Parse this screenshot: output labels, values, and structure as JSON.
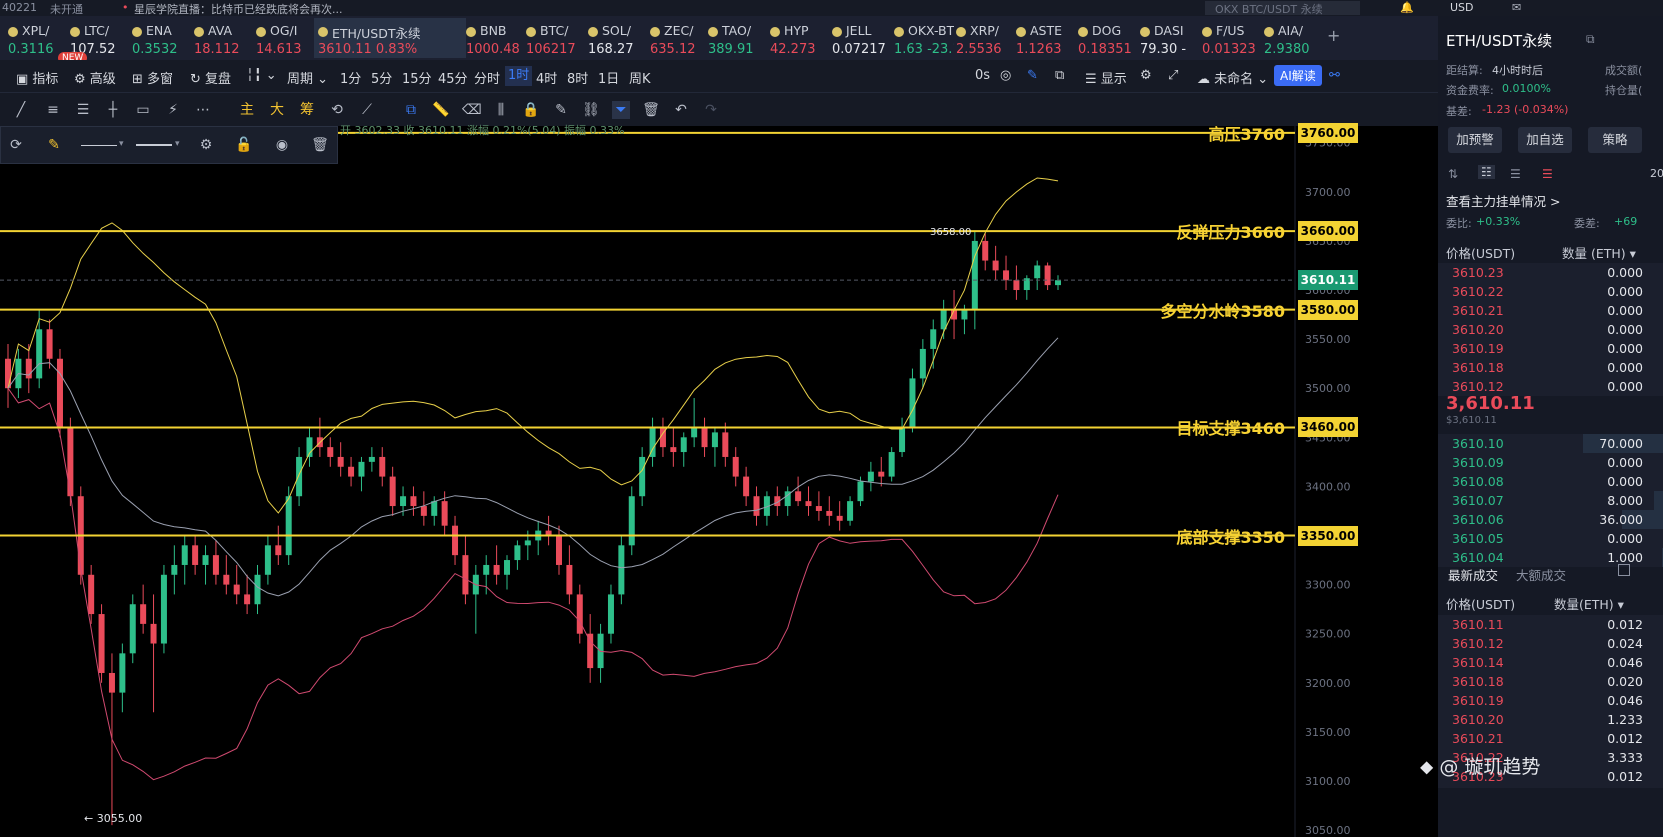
{
  "topbar": {
    "left_code": "40221",
    "badge": "未开通",
    "news": "星辰学院直播：比特币已经跌底将会再次...",
    "search_placeholder": "OKX BTC/USDT 永续",
    "currency": "USD"
  },
  "tickers": [
    {
      "name": "XPL/",
      "price": "0.3116",
      "dir": "up"
    },
    {
      "name": "LTC/",
      "price": "107.52",
      "dir": "wh"
    },
    {
      "name": "ENA",
      "price": "0.3532",
      "dir": "up"
    },
    {
      "name": "AVA",
      "price": "18.112",
      "dir": "dn"
    },
    {
      "name": "OG/I",
      "price": "14.613",
      "dir": "dn"
    },
    {
      "name": "ETH/USDT永续",
      "price": "3610.11  0.83%",
      "dir": "dn",
      "active": true
    },
    {
      "name": "BNB",
      "price": "1000.48",
      "dir": "dn"
    },
    {
      "name": "BTC/",
      "price": "106217",
      "dir": "dn"
    },
    {
      "name": "SOL/",
      "price": "168.27",
      "dir": "wh"
    },
    {
      "name": "ZEC/",
      "price": "635.12",
      "dir": "dn"
    },
    {
      "name": "TAO/",
      "price": "389.91",
      "dir": "up"
    },
    {
      "name": "HYP",
      "price": "42.273",
      "dir": "dn"
    },
    {
      "name": "JELL",
      "price": "0.07217",
      "dir": "wh"
    },
    {
      "name": "OKX-BTC",
      "price": "1.63  -23.1",
      "dir": "up"
    },
    {
      "name": "XRP/",
      "price": "2.5536",
      "dir": "dn"
    },
    {
      "name": "ASTE",
      "price": "1.1263",
      "dir": "dn"
    },
    {
      "name": "DOG",
      "price": "0.18351",
      "dir": "dn"
    },
    {
      "name": "DASI",
      "price": "79.30  -",
      "dir": "wh"
    },
    {
      "name": "F/US",
      "price": "0.01323",
      "dir": "dn"
    },
    {
      "name": "AIA/",
      "price": "2.9380",
      "dir": "up"
    }
  ],
  "new_badge": "NEW",
  "toolbar": {
    "indicators": "指标",
    "advanced": "高级",
    "multi": "多窗",
    "replay": "复盘",
    "period": "周期",
    "periods": [
      "1分",
      "5分",
      "15分",
      "45分",
      "分时",
      "1时",
      "4时",
      "8时",
      "1日",
      "周K"
    ],
    "active_period": "1时",
    "countdown": "0s",
    "display": "显示",
    "unnamed": "未命名",
    "ai": "AI解读"
  },
  "tools2": {
    "main": "主",
    "big": "大",
    "chips": "筹"
  },
  "ohlc_line": "开 3602.33  收 3610.11  涨幅 0.21%(5.04)  振幅 0.33%",
  "levels": [
    {
      "label": "高压3760",
      "tag": "3760.00",
      "price": 3760
    },
    {
      "label": "反弹压力3660",
      "tag": "3660.00",
      "price": 3660
    },
    {
      "label": "多空分水岭3580",
      "tag": "3580.00",
      "price": 3580
    },
    {
      "label": "目标支撑3460",
      "tag": "3460.00",
      "price": 3460
    },
    {
      "label": "底部支撑3350",
      "tag": "3350.00",
      "price": 3350
    }
  ],
  "current_price_tag": "3610.11",
  "high_marker": "3658.00",
  "low_marker": "← 3055.00",
  "y_ticks": [
    "3750.00",
    "3700.00",
    "3650.00",
    "3600.00",
    "3550.00",
    "3500.00",
    "3450.00",
    "3400.00",
    "3350.00",
    "3300.00",
    "3250.00",
    "3200.00",
    "3150.00",
    "3100.00",
    "3050.00"
  ],
  "chart_data": {
    "type": "candlestick",
    "title": "ETH/USDT永续 1时",
    "ylim": [
      3045,
      3765
    ],
    "candles": [
      [
        3530,
        3545,
        3480,
        3500
      ],
      [
        3500,
        3540,
        3490,
        3530
      ],
      [
        3530,
        3545,
        3495,
        3510
      ],
      [
        3510,
        3580,
        3500,
        3560
      ],
      [
        3560,
        3570,
        3520,
        3530
      ],
      [
        3530,
        3540,
        3450,
        3460
      ],
      [
        3460,
        3470,
        3380,
        3390
      ],
      [
        3390,
        3400,
        3300,
        3310
      ],
      [
        3310,
        3320,
        3260,
        3270
      ],
      [
        3270,
        3280,
        3200,
        3210
      ],
      [
        3210,
        3230,
        3055,
        3190
      ],
      [
        3190,
        3240,
        3170,
        3230
      ],
      [
        3230,
        3290,
        3220,
        3280
      ],
      [
        3280,
        3300,
        3250,
        3260
      ],
      [
        3260,
        3290,
        3170,
        3240
      ],
      [
        3240,
        3320,
        3230,
        3310
      ],
      [
        3310,
        3340,
        3290,
        3320
      ],
      [
        3320,
        3350,
        3300,
        3340
      ],
      [
        3340,
        3350,
        3310,
        3320
      ],
      [
        3320,
        3340,
        3300,
        3330
      ],
      [
        3330,
        3345,
        3300,
        3310
      ],
      [
        3310,
        3330,
        3290,
        3300
      ],
      [
        3300,
        3320,
        3280,
        3290
      ],
      [
        3290,
        3310,
        3270,
        3280
      ],
      [
        3280,
        3320,
        3270,
        3310
      ],
      [
        3310,
        3350,
        3300,
        3340
      ],
      [
        3340,
        3360,
        3320,
        3330
      ],
      [
        3330,
        3400,
        3320,
        3390
      ],
      [
        3390,
        3440,
        3380,
        3430
      ],
      [
        3430,
        3460,
        3420,
        3450
      ],
      [
        3450,
        3470,
        3430,
        3440
      ],
      [
        3440,
        3450,
        3420,
        3430
      ],
      [
        3430,
        3445,
        3410,
        3420
      ],
      [
        3420,
        3430,
        3400,
        3410
      ],
      [
        3410,
        3430,
        3395,
        3425
      ],
      [
        3425,
        3440,
        3415,
        3430
      ],
      [
        3430,
        3440,
        3400,
        3410
      ],
      [
        3410,
        3420,
        3370,
        3380
      ],
      [
        3380,
        3400,
        3370,
        3390
      ],
      [
        3390,
        3400,
        3370,
        3380
      ],
      [
        3380,
        3395,
        3360,
        3370
      ],
      [
        3370,
        3390,
        3360,
        3385
      ],
      [
        3385,
        3395,
        3350,
        3360
      ],
      [
        3360,
        3370,
        3320,
        3330
      ],
      [
        3330,
        3350,
        3280,
        3290
      ],
      [
        3290,
        3320,
        3250,
        3310
      ],
      [
        3310,
        3330,
        3290,
        3320
      ],
      [
        3320,
        3340,
        3300,
        3310
      ],
      [
        3310,
        3330,
        3295,
        3325
      ],
      [
        3325,
        3345,
        3315,
        3340
      ],
      [
        3340,
        3355,
        3325,
        3345
      ],
      [
        3345,
        3365,
        3330,
        3355
      ],
      [
        3355,
        3370,
        3340,
        3350
      ],
      [
        3350,
        3360,
        3310,
        3320
      ],
      [
        3320,
        3340,
        3280,
        3290
      ],
      [
        3290,
        3300,
        3240,
        3250
      ],
      [
        3250,
        3270,
        3200,
        3215
      ],
      [
        3215,
        3260,
        3200,
        3250
      ],
      [
        3250,
        3300,
        3240,
        3290
      ],
      [
        3290,
        3350,
        3280,
        3340
      ],
      [
        3340,
        3400,
        3330,
        3390
      ],
      [
        3390,
        3440,
        3380,
        3430
      ],
      [
        3430,
        3470,
        3420,
        3460
      ],
      [
        3460,
        3470,
        3430,
        3440
      ],
      [
        3440,
        3460,
        3420,
        3435
      ],
      [
        3435,
        3455,
        3420,
        3450
      ],
      [
        3450,
        3490,
        3440,
        3460
      ],
      [
        3460,
        3470,
        3430,
        3440
      ],
      [
        3440,
        3460,
        3420,
        3455
      ],
      [
        3455,
        3465,
        3420,
        3430
      ],
      [
        3430,
        3440,
        3400,
        3410
      ],
      [
        3410,
        3420,
        3380,
        3390
      ],
      [
        3390,
        3400,
        3360,
        3370
      ],
      [
        3370,
        3395,
        3360,
        3390
      ],
      [
        3390,
        3400,
        3370,
        3380
      ],
      [
        3380,
        3400,
        3370,
        3395
      ],
      [
        3395,
        3410,
        3380,
        3385
      ],
      [
        3385,
        3400,
        3370,
        3380
      ],
      [
        3380,
        3395,
        3365,
        3375
      ],
      [
        3375,
        3390,
        3360,
        3370
      ],
      [
        3370,
        3385,
        3355,
        3365
      ],
      [
        3365,
        3390,
        3360,
        3385
      ],
      [
        3385,
        3410,
        3380,
        3405
      ],
      [
        3405,
        3425,
        3395,
        3415
      ],
      [
        3415,
        3430,
        3400,
        3410
      ],
      [
        3410,
        3440,
        3405,
        3435
      ],
      [
        3435,
        3470,
        3430,
        3460
      ],
      [
        3460,
        3520,
        3455,
        3510
      ],
      [
        3510,
        3550,
        3500,
        3540
      ],
      [
        3540,
        3570,
        3520,
        3560
      ],
      [
        3560,
        3590,
        3550,
        3580
      ],
      [
        3580,
        3600,
        3550,
        3570
      ],
      [
        3570,
        3585,
        3555,
        3580
      ],
      [
        3580,
        3660,
        3560,
        3650
      ],
      [
        3650,
        3658,
        3620,
        3630
      ],
      [
        3630,
        3645,
        3610,
        3620
      ],
      [
        3620,
        3635,
        3600,
        3610
      ],
      [
        3610,
        3625,
        3590,
        3600
      ],
      [
        3600,
        3615,
        3590,
        3612
      ],
      [
        3612,
        3630,
        3600,
        3625
      ],
      [
        3625,
        3628,
        3600,
        3605
      ],
      [
        3605,
        3615,
        3600,
        3610
      ]
    ],
    "series": []
  },
  "right": {
    "symbol": "ETH/USDT永续",
    "settle_label": "距结算:",
    "settle_val": "4小时时后",
    "funding_label": "资金费率:",
    "funding_val": "0.0100%",
    "basis_label": "基差:",
    "basis_val": "-1.23 (-0.034%)",
    "vol_label": "成交额(",
    "oi_label": "持仓量(",
    "btn_alert": "加预警",
    "btn_fav": "加自选",
    "btn_strategy": "策略",
    "depth_num": "20",
    "main_orders": "查看主力挂单情况 >",
    "ratio_label": "委比:",
    "ratio_val": "+0.33%",
    "diff_label": "委差:",
    "diff_val": "+69",
    "col_price": "价格(USDT)",
    "col_qty": "数量 (ETH) ▾",
    "asks": [
      [
        "3610.23",
        "0.000"
      ],
      [
        "3610.22",
        "0.000"
      ],
      [
        "3610.21",
        "0.000"
      ],
      [
        "3610.20",
        "0.000"
      ],
      [
        "3610.19",
        "0.000"
      ],
      [
        "3610.18",
        "0.000"
      ],
      [
        "3610.12",
        "0.000"
      ]
    ],
    "last_price": "3,610.11",
    "last_usd": "$3,610.11",
    "bids": [
      [
        "3610.10",
        "70.000"
      ],
      [
        "3610.09",
        "0.000"
      ],
      [
        "3610.08",
        "0.000"
      ],
      [
        "3610.07",
        "8.000"
      ],
      [
        "3610.06",
        "36.000"
      ],
      [
        "3610.05",
        "0.000"
      ],
      [
        "3610.04",
        "1.000"
      ]
    ],
    "tab_trades": "最新成交",
    "tab_big": "大额成交",
    "col_price2": "价格(USDT)",
    "col_qty2": "数量(ETH) ▾",
    "trades": [
      [
        "3610.11",
        "0.012"
      ],
      [
        "3610.12",
        "0.024"
      ],
      [
        "3610.14",
        "0.046"
      ],
      [
        "3610.18",
        "0.020"
      ],
      [
        "3610.19",
        "0.046"
      ],
      [
        "3610.20",
        "1.233"
      ],
      [
        "3610.21",
        "0.012"
      ],
      [
        "3610.22",
        "3.333"
      ],
      [
        "3610.23",
        "0.012"
      ]
    ]
  },
  "watermark": "璇玑趋势"
}
